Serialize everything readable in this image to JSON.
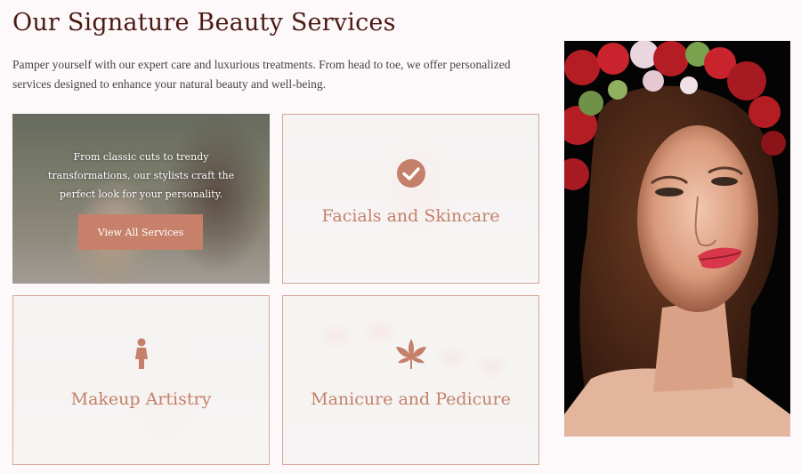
{
  "section": {
    "title": "Our Signature Beauty Services",
    "intro": "Pamper yourself with our expert care and luxurious treatments. From head to toe, we offer personalized services designed to enhance your natural beauty and well-being."
  },
  "cards": {
    "hair": {
      "description": "From classic cuts to trendy transformations, our stylists craft the perfect look for your personality.",
      "button_label": "View All Services"
    },
    "facial": {
      "title": "Facials and Skincare",
      "icon": "check-circle-icon"
    },
    "makeup": {
      "title": "Makeup Artistry",
      "icon": "woman-icon"
    },
    "nails": {
      "title": "Manicure and Pedicure",
      "icon": "leaf-icon"
    }
  },
  "colors": {
    "heading": "#4a1a12",
    "accent": "#c4806a",
    "border": "#d8a797",
    "button": "#c7816a"
  },
  "portrait": {
    "icon": "portrait-image"
  }
}
